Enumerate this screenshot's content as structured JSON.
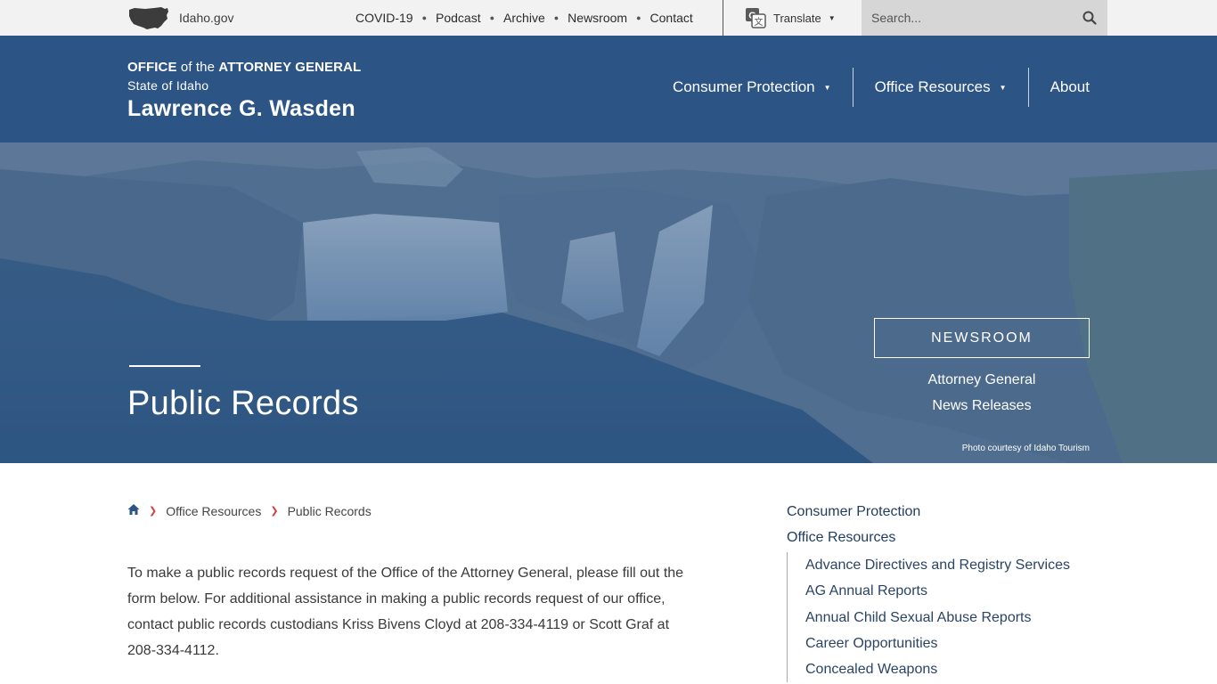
{
  "utility": {
    "site_label": "Idaho.gov",
    "links": [
      "COVID-19",
      "Podcast",
      "Archive",
      "Newsroom",
      "Contact"
    ],
    "translate_label": "Translate",
    "search_placeholder": "Search..."
  },
  "header": {
    "office_word": "OFFICE",
    "of_the": " of the ",
    "ag_word": "ATTORNEY GENERAL",
    "state": "State of Idaho",
    "name": "Lawrence G. Wasden",
    "nav": [
      {
        "label": "Consumer Protection",
        "dropdown": true
      },
      {
        "label": "Office Resources",
        "dropdown": true
      },
      {
        "label": "About",
        "dropdown": false
      }
    ]
  },
  "hero": {
    "title": "Public Records",
    "newsroom_button": "NEWSROOM",
    "newsroom_sub1": "Attorney General",
    "newsroom_sub2": "News Releases",
    "photo_credit": "Photo courtesy of Idaho Tourism"
  },
  "breadcrumb": {
    "items": [
      "Office Resources",
      "Public Records"
    ]
  },
  "content": {
    "intro": "To make a public records request of the Office of the Attorney General, please fill out the form below. For additional assistance in making a public records request of our office, contact public records custodians Kriss Bivens Cloyd at 208-334-4119 or Scott Graf at 208-334-4112."
  },
  "sidebar": {
    "top_items": [
      "Consumer Protection",
      "Office Resources"
    ],
    "sub_items": [
      "Advance Directives and Registry Services",
      "AG Annual Reports",
      "Annual Child Sexual Abuse Reports",
      "Career Opportunities",
      "Concealed Weapons"
    ]
  },
  "colors": {
    "header_blue": "#2c5586",
    "utility_gray": "#f2f2f2",
    "breadcrumb_separator": "#cc4444"
  }
}
